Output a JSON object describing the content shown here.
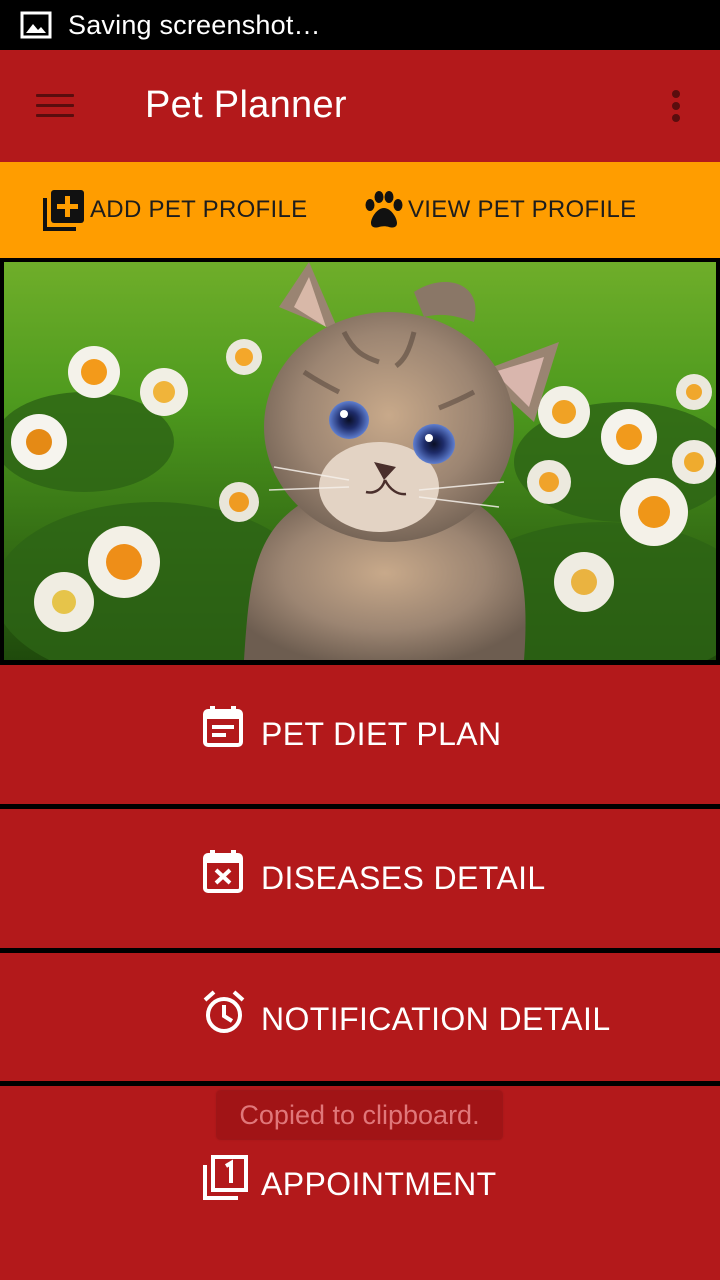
{
  "status_bar": {
    "notification_icon": "image-icon",
    "text": "Saving screenshot…"
  },
  "app_bar": {
    "title": "Pet Planner",
    "menu_icon": "hamburger-menu-icon",
    "overflow_icon": "more-vert-icon"
  },
  "action_bar": {
    "add_profile": {
      "label": "ADD PET PROFILE",
      "icon": "add-to-photos-icon"
    },
    "view_profile": {
      "label": "VIEW PET PROFILE",
      "icon": "paw-icon"
    }
  },
  "hero_image": {
    "subject": "kitten-among-daisies"
  },
  "menu_items": [
    {
      "label": "PET DIET PLAN",
      "icon": "calendar-note-icon"
    },
    {
      "label": "DISEASES DETAIL",
      "icon": "calendar-remove-icon"
    },
    {
      "label": "NOTIFICATION DETAIL",
      "icon": "alarm-clock-icon"
    },
    {
      "label": "APPOINTMENT",
      "icon": "filter-1-icon"
    }
  ],
  "toast": {
    "text": "Copied to clipboard."
  },
  "colors": {
    "primary": "#B3191B",
    "accent": "#FF9D00",
    "status_bar": "#000000"
  }
}
